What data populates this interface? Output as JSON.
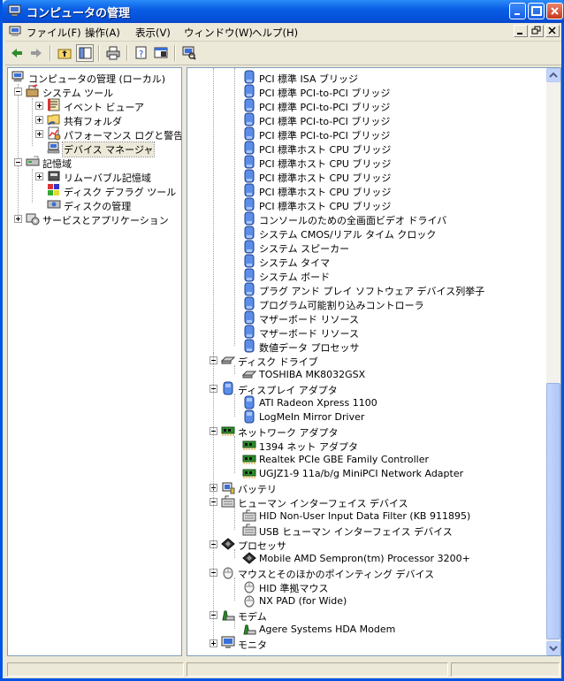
{
  "window": {
    "title": "コンピュータの管理",
    "icon": "computer-management-icon"
  },
  "menu": [
    {
      "label": "ファイル(F)"
    },
    {
      "label": "操作(A)"
    },
    {
      "label": "表示(V)"
    },
    {
      "label": "ウィンドウ(W)"
    },
    {
      "label": "ヘルプ(H)"
    }
  ],
  "toolbar": [
    "back-arrow-icon",
    "forward-arrow-icon",
    "up-folder-icon",
    "show-hide-tree-icon",
    "print-icon",
    "properties-icon",
    "help-icon",
    "scan-hardware-icon"
  ],
  "tree": {
    "root": "コンピュータの管理 (ローカル)",
    "system_tools": "システム ツール",
    "event_viewer": "イベント ビューア",
    "shared_folders": "共有フォルダ",
    "performance": "パフォーマンス ログと警告",
    "device_manager": "デバイス マネージャ",
    "storage": "記憶域",
    "removable_storage": "リムーバブル記憶域",
    "disk_defrag": "ディスク デフラグ ツール",
    "disk_management": "ディスクの管理",
    "services_apps": "サービスとアプリケーション"
  },
  "devices": {
    "system_devices": [
      "PCI 標準 ISA ブリッジ",
      "PCI 標準 PCI-to-PCI ブリッジ",
      "PCI 標準 PCI-to-PCI ブリッジ",
      "PCI 標準 PCI-to-PCI ブリッジ",
      "PCI 標準 PCI-to-PCI ブリッジ",
      "PCI 標準ホスト CPU ブリッジ",
      "PCI 標準ホスト CPU ブリッジ",
      "PCI 標準ホスト CPU ブリッジ",
      "PCI 標準ホスト CPU ブリッジ",
      "PCI 標準ホスト CPU ブリッジ",
      "コンソールのための全画面ビデオ ドライバ",
      "システム CMOS/リアル タイム クロック",
      "システム スピーカー",
      "システム タイマ",
      "システム ボード",
      "プラグ アンド プレイ ソフトウェア デバイス列挙子",
      "プログラム可能割り込みコントローラ",
      "マザーボード リソース",
      "マザーボード リソース",
      "数値データ プロセッサ"
    ],
    "categories": [
      {
        "label": "ディスク ドライブ",
        "expanded": true,
        "icon": "disk-drive-icon",
        "children": [
          "TOSHIBA MK8032GSX"
        ]
      },
      {
        "label": "ディスプレイ アダプタ",
        "expanded": true,
        "icon": "display-adapter-icon",
        "children": [
          "ATI Radeon Xpress 1100",
          "LogMeIn Mirror Driver"
        ]
      },
      {
        "label": "ネットワーク アダプタ",
        "expanded": true,
        "icon": "network-adapter-icon",
        "children": [
          "1394 ネット アダプタ",
          "Realtek PCIe GBE Family Controller",
          "UGJZ1-9 11a/b/g MiniPCI Network Adapter"
        ]
      },
      {
        "label": "バッテリ",
        "expanded": false,
        "icon": "battery-icon",
        "children": []
      },
      {
        "label": "ヒューマン インターフェイス デバイス",
        "expanded": true,
        "icon": "hid-icon",
        "children": [
          "HID Non-User Input Data Filter (KB 911895)",
          "USB ヒューマン インターフェイス デバイス"
        ]
      },
      {
        "label": "プロセッサ",
        "expanded": true,
        "icon": "processor-icon",
        "children": [
          "Mobile AMD Sempron(tm) Processor 3200+"
        ]
      },
      {
        "label": "マウスとそのほかのポインティング デバイス",
        "expanded": true,
        "icon": "mouse-icon",
        "children": [
          "HID 準拠マウス",
          "NX PAD (for Wide)"
        ]
      },
      {
        "label": "モデム",
        "expanded": true,
        "icon": "modem-icon",
        "children": [
          "Agere Systems HDA Modem"
        ]
      },
      {
        "label": "モニタ",
        "expanded": false,
        "icon": "monitor-icon",
        "children": []
      }
    ]
  },
  "colors": {
    "title_blue": "#0a5ee4",
    "selection": "#ece9d8",
    "border": "#7f9db9"
  }
}
